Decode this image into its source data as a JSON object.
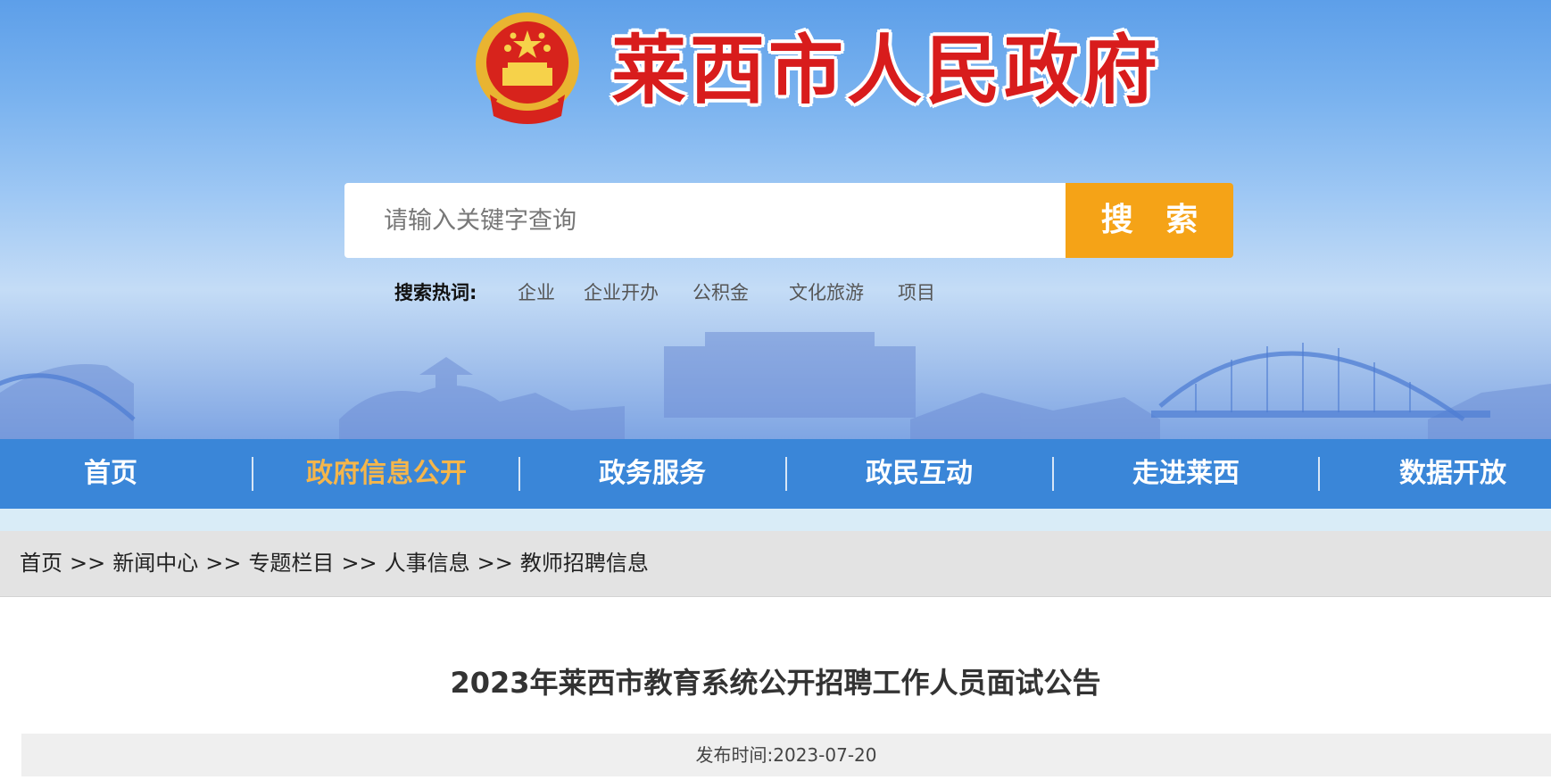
{
  "header": {
    "site_title": "莱西市人民政府",
    "emblem_icon": "national-emblem-icon"
  },
  "search": {
    "placeholder": "请输入关键字查询",
    "value": "",
    "button_label": "搜 索",
    "hot_label": "搜索热词:",
    "hot_words": [
      "企业",
      "企业开办",
      "公积金",
      "文化旅游",
      "项目"
    ]
  },
  "nav": {
    "items": [
      "首页",
      "政府信息公开",
      "政务服务",
      "政民互动",
      "走进莱西",
      "数据开放"
    ],
    "active_index": 1
  },
  "breadcrumb": {
    "items": [
      "首页",
      "新闻中心",
      "专题栏目",
      "人事信息",
      "教师招聘信息"
    ],
    "separator": ">>"
  },
  "article": {
    "title": "2023年莱西市教育系统公开招聘工作人员面试公告",
    "date_label": "发布时间:",
    "date": "2023-07-20"
  },
  "colors": {
    "banner_top": "#5d9fe9",
    "nav_bg": "#3a86d8",
    "nav_active": "#f5b64b",
    "search_button": "#f5a317",
    "title_red": "#d81c1c"
  }
}
